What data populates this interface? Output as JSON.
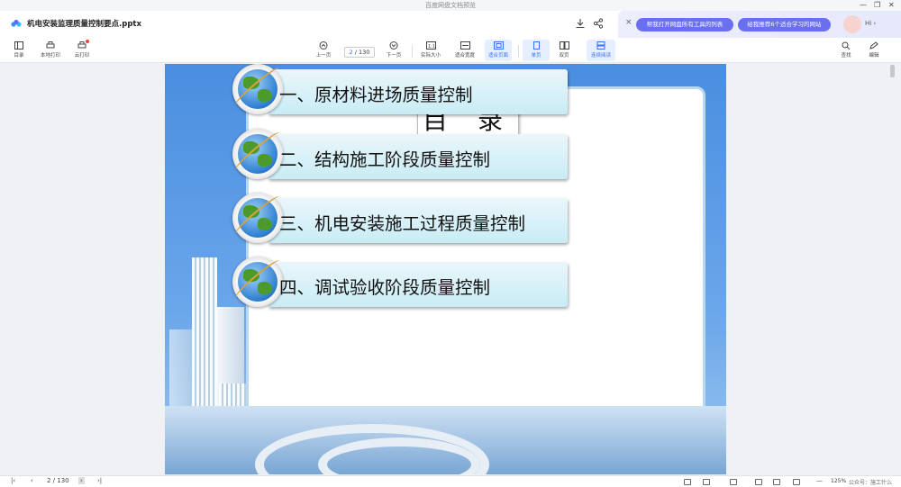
{
  "window": {
    "title": "百度网盘文档预览"
  },
  "header": {
    "doc_title": "机电安装监理质量控制要点.pptx",
    "promo": {
      "close": "×",
      "pill1": "帮我打开网盘所有工具的列表",
      "pill2": "给我推荐6个适合学习的网站",
      "hi": "Hi ›"
    }
  },
  "toolbar": {
    "catalog": "目录",
    "local_print": "本地打印",
    "cloud_print": "云打印",
    "prev_page": "上一页",
    "page_current": "2",
    "page_total": "/ 130",
    "next_page": "下一页",
    "actual_size": "实际大小",
    "fit_width": "适合宽度",
    "fit_page": "适合页面",
    "single_page": "单页",
    "double_page": "双页",
    "continuous": "连续阅读",
    "search": "查找",
    "annotate": "编辑"
  },
  "slide": {
    "toc_title": "目 录",
    "items": [
      "一、原材料进场质量控制",
      "二、结构施工阶段质量控制",
      "三、机电安装施工过程质量控制",
      "四、调试验收阶段质量控制"
    ]
  },
  "statusbar": {
    "page": "2 / 130",
    "zoom": "125%",
    "watermark": "公众号：施工什么"
  },
  "colors": {
    "accent": "#3a6ff0",
    "promo_pill": "#6a6ff0",
    "slide_bg": "#4a8ee0"
  }
}
